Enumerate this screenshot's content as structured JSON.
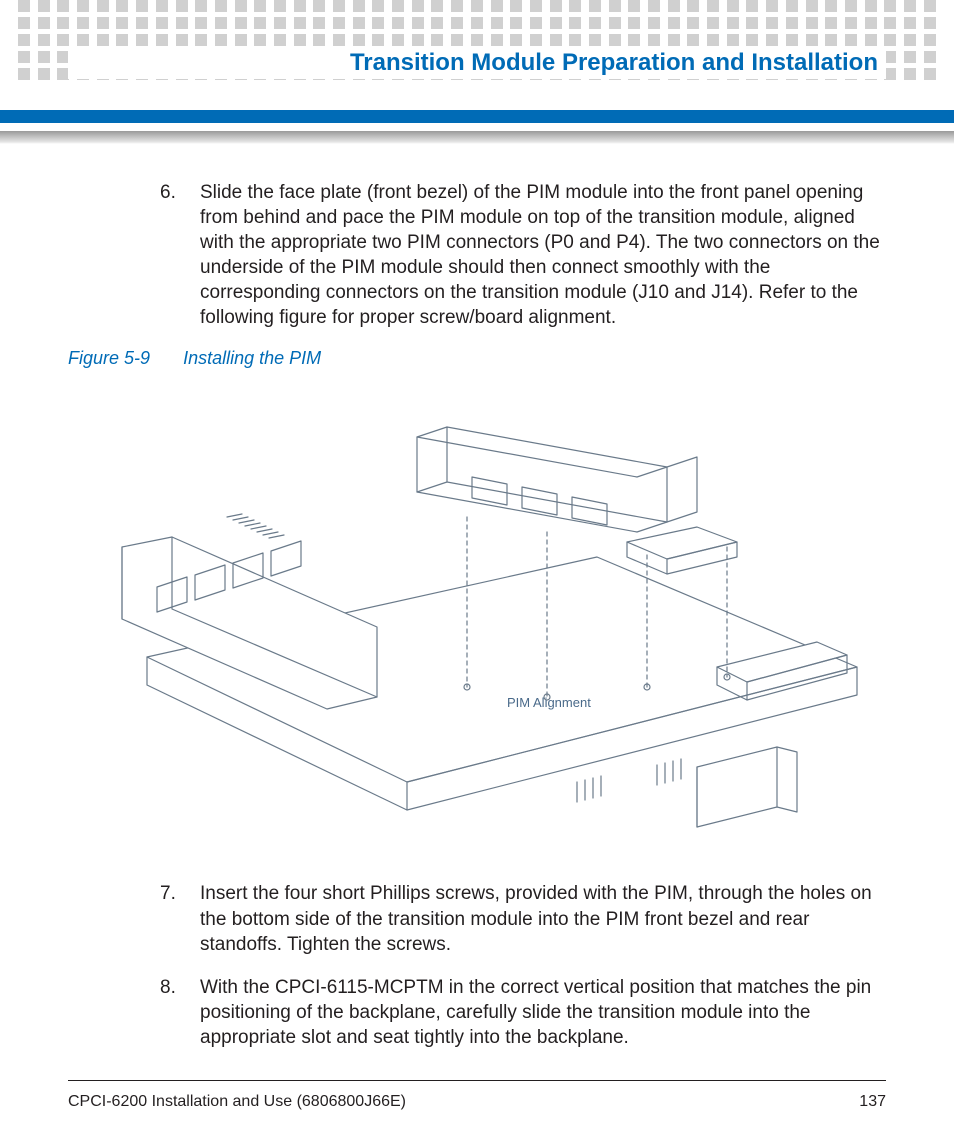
{
  "header": {
    "section_title": "Transition Module Preparation and Installation"
  },
  "steps": [
    {
      "num": "6.",
      "text": "Slide the face plate (front bezel) of the PIM module into the front panel opening from behind and pace the PIM module on top of the transition module, aligned with the appropriate two PIM connectors (P0 and P4). The two connectors on the underside of the PIM module should then connect smoothly with the corresponding connectors on the transition module (J10 and J14). Refer to the following figure for proper screw/board alignment."
    },
    {
      "num": "7.",
      "text": "Insert the four short Phillips screws, provided with the PIM, through the holes on the bottom side of the transition module into the PIM front bezel and rear standoffs. Tighten the screws."
    },
    {
      "num": "8.",
      "text": "With the CPCI-6115-MCPTM in the correct vertical position that matches the pin positioning of the backplane, carefully slide the transition module into the appropriate slot and seat tightly into the backplane."
    }
  ],
  "figure": {
    "number": "Figure 5-9",
    "caption": "Installing the PIM",
    "annotation": "PIM Alignment"
  },
  "footer": {
    "left": "CPCI-6200 Installation and Use (6806800J66E)",
    "page": "137"
  }
}
